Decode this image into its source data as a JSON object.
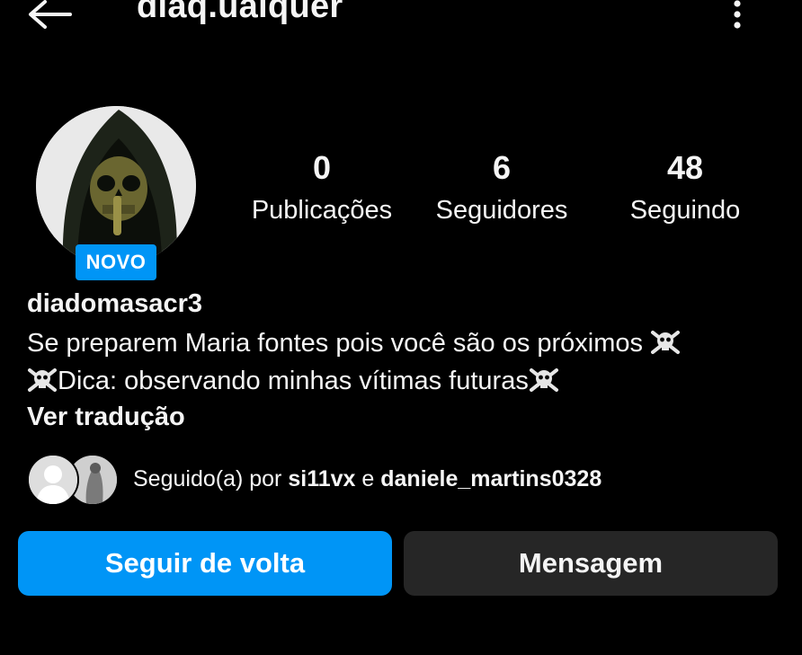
{
  "header": {
    "username": "diaq.ualquer",
    "back_icon": "arrow-left-icon",
    "more_icon": "more-vertical-icon"
  },
  "profile": {
    "badge": "NOVO",
    "name": "diadomasacr3",
    "bio_line1": "Se preparem Maria fontes pois você são os próximos",
    "bio_line2_prefix": "Dica: observando minhas vítimas futuras",
    "bio_emoji": "☠️",
    "translate_label": "Ver tradução"
  },
  "stats": [
    {
      "value": "0",
      "label": "Publicações"
    },
    {
      "value": "6",
      "label": "Seguidores"
    },
    {
      "value": "48",
      "label": "Seguindo"
    }
  ],
  "followed_by": {
    "prefix": "Seguido(a) por",
    "user1": "si11vx",
    "connector": "e",
    "user2": "daniele_martins0328"
  },
  "actions": {
    "follow_back_label": "Seguir de volta",
    "message_label": "Mensagem"
  },
  "colors": {
    "background": "#000000",
    "accent": "#0095f6",
    "secondary_button": "#262626",
    "text": "#f5f5f5"
  }
}
